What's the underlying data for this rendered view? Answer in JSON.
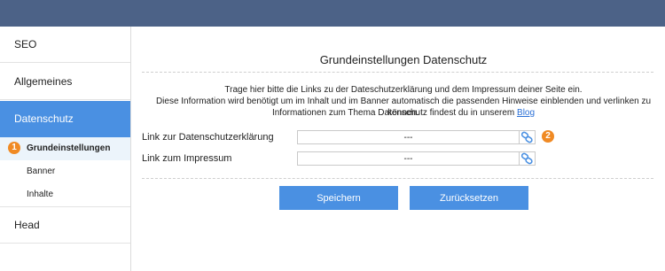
{
  "sidebar": {
    "items": [
      {
        "label": "SEO"
      },
      {
        "label": "Allgemeines"
      },
      {
        "label": "Datenschutz"
      },
      {
        "label": "Head"
      }
    ],
    "subitems": [
      {
        "label": "Grundeinstellungen"
      },
      {
        "label": "Banner"
      },
      {
        "label": "Inhalte"
      }
    ],
    "badge": "1"
  },
  "main": {
    "title": "Grundeinstellungen Datenschutz",
    "desc_line1": "Trage hier bitte die Links zu der Dateschutzerklärung und dem Impressum deiner Seite ein.",
    "desc_line2": "Diese Information wird benötigt um im Inhalt und im Banner automatisch die passenden Hinweise einblenden und verlinken zu können.",
    "desc_line3_prefix": "Informationen zum Thema Datenschutz findest du in unserem",
    "desc_link": "Blog",
    "fields": [
      {
        "label": "Link zur Datenschutzerklärung",
        "value": "---"
      },
      {
        "label": "Link zum Impressum",
        "value": "---"
      }
    ],
    "badge": "2",
    "save_label": "Speichern",
    "reset_label": "Zurücksetzen"
  },
  "colors": {
    "topbar": "#4c6287",
    "accent": "#4a90e2",
    "badge": "#f08a24"
  }
}
